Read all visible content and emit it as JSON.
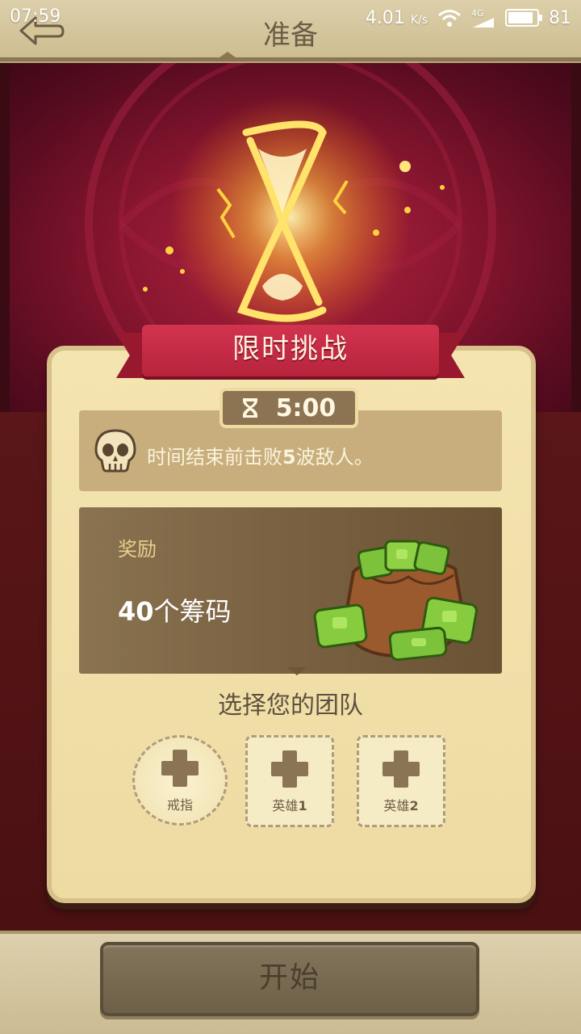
{
  "status_bar": {
    "time": "07:59",
    "speed": "4.01",
    "speed_unit": "K/s",
    "network": "4G",
    "battery": "81"
  },
  "header": {
    "title": "准备"
  },
  "challenge": {
    "banner_title": "限时挑战",
    "timer": "5:00",
    "objective_prefix": "时间结束前击败",
    "objective_count": "5",
    "objective_suffix": "波敌人。"
  },
  "reward": {
    "label": "奖励",
    "amount": "40",
    "unit": "个筹码"
  },
  "team": {
    "title": "选择您的团队",
    "slots": [
      {
        "label": "戒指"
      },
      {
        "label": "英雄",
        "number": "1"
      },
      {
        "label": "英雄",
        "number": "2"
      }
    ]
  },
  "footer": {
    "start_label": "开始"
  },
  "colors": {
    "banner": "#c42a44",
    "card": "#f1dfa9",
    "accent_gold": "#ffd860",
    "chip_green": "#7cc23a"
  }
}
